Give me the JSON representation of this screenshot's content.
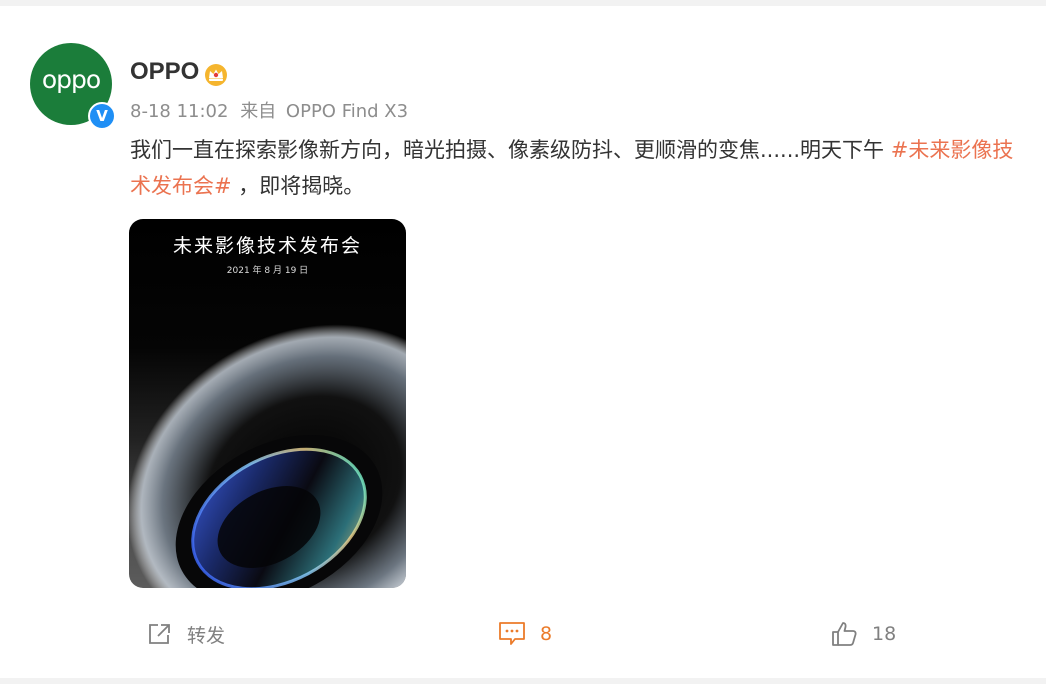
{
  "post": {
    "avatar_text": "oppo",
    "username": "OPPO",
    "timestamp": "8-18 11:02",
    "source_prefix": "来自",
    "source": "OPPO Find X3",
    "text_before": "我们一直在探索影像新方向，暗光拍摄、像素级防抖、更顺滑的变焦......明天下午 ",
    "hashtag": "#未来影像技术发布会#",
    "text_after": " ，即将揭晓。",
    "poster": {
      "title": "未来影像技术发布会",
      "date": "2021 年 8 月 19 日"
    }
  },
  "actions": {
    "repost_label": "转发",
    "comment_count": "8",
    "like_count": "18"
  },
  "icons": {
    "verified": "verified-badge-icon",
    "crown": "crown-icon",
    "repost": "share-icon",
    "comment": "comment-icon",
    "like": "thumbs-up-icon"
  },
  "colors": {
    "hashtag": "#eb7350",
    "comment_accent": "#eb7b2a",
    "avatar_bg": "#1b7d3a",
    "verified_bg": "#1f8ff5"
  }
}
